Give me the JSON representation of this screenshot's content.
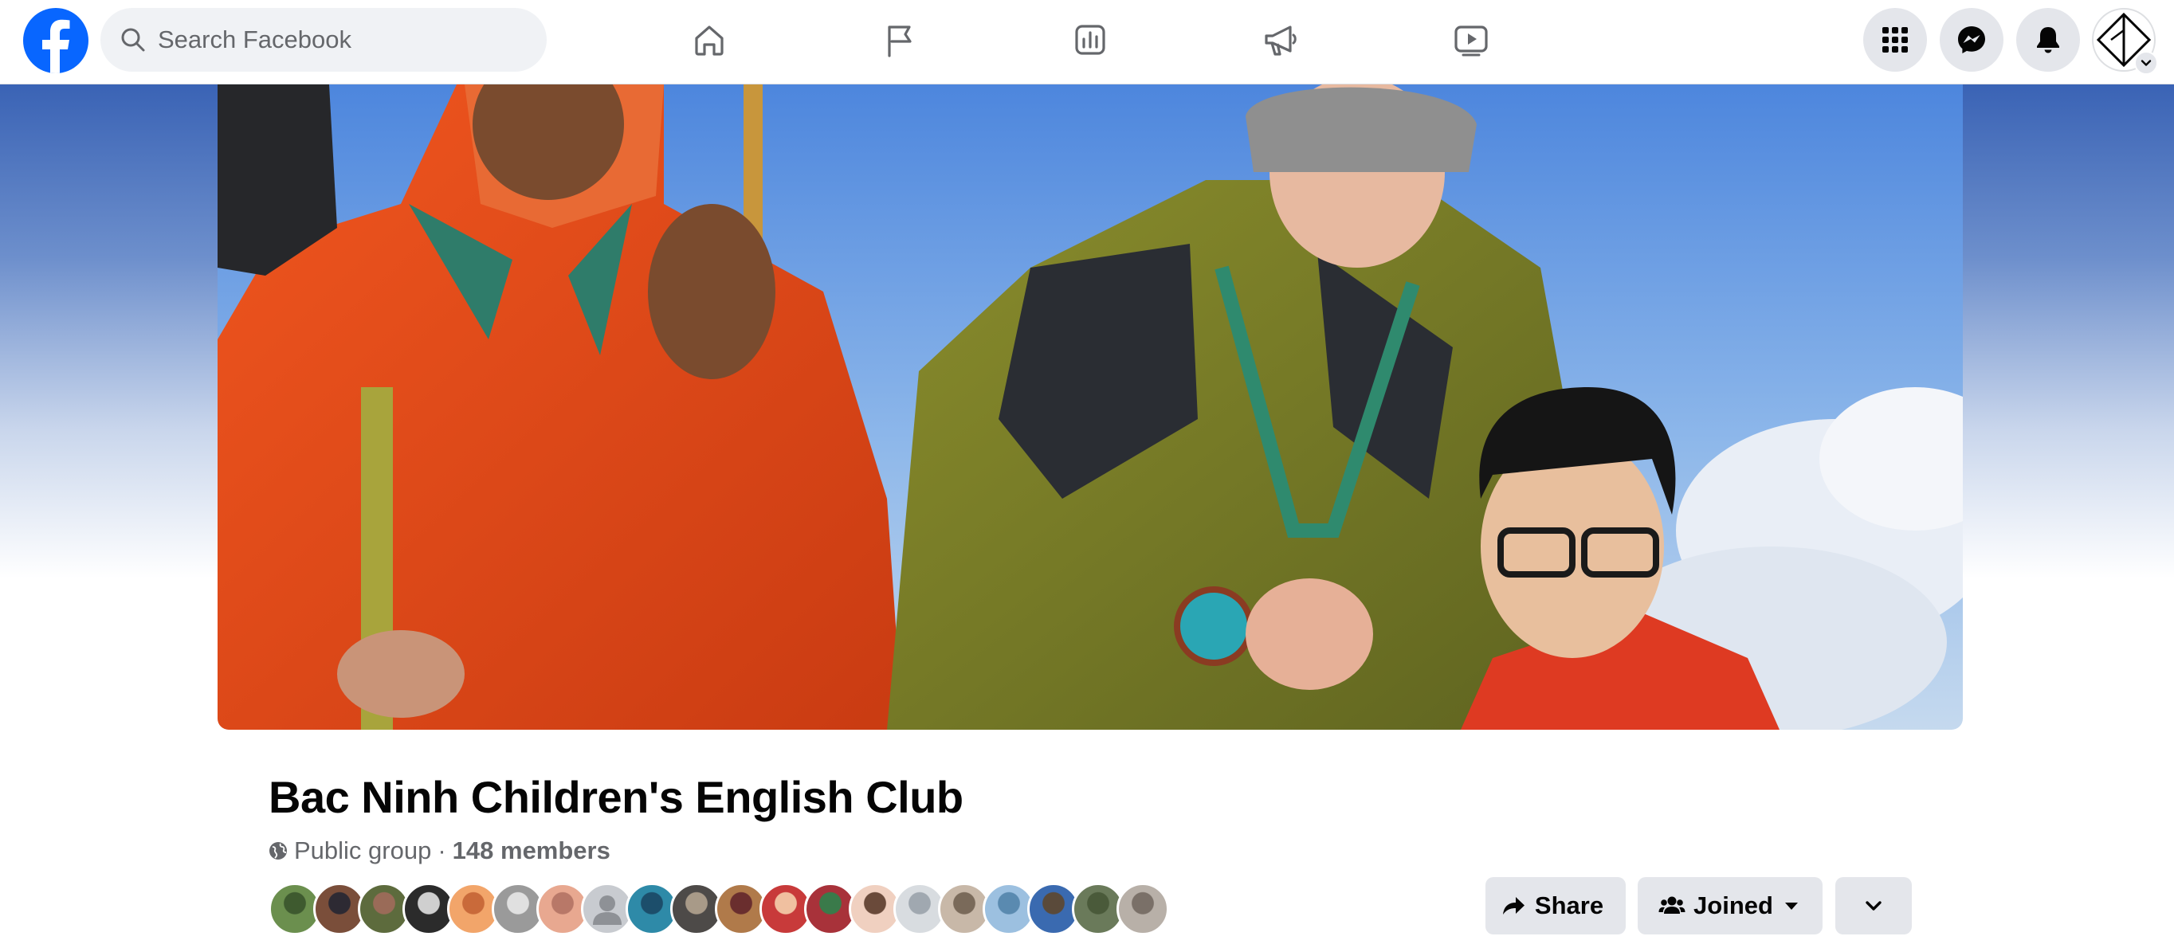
{
  "topbar": {
    "logo_icon": "facebook-logo-icon",
    "search": {
      "placeholder": "Search Facebook",
      "value": ""
    },
    "nav": [
      {
        "icon": "home-icon"
      },
      {
        "icon": "flag-icon"
      },
      {
        "icon": "insights-chart-icon"
      },
      {
        "icon": "megaphone-icon"
      },
      {
        "icon": "video-play-icon"
      }
    ],
    "right_buttons": [
      {
        "icon": "menu-grid-icon"
      },
      {
        "icon": "messenger-icon"
      },
      {
        "icon": "bell-icon"
      }
    ],
    "account_icon": "account-avatar-icon"
  },
  "colors": {
    "brand": "#0866ff",
    "text_primary": "#050505",
    "text_secondary": "#65676b",
    "button_bg": "#e4e6eb",
    "search_bg": "#f0f2f5"
  },
  "group": {
    "name": "Bac Ninh Children's English Club",
    "privacy": "Public group",
    "separator": "·",
    "members": "148 members",
    "member_avatar_count": 20
  },
  "actions": {
    "share_label": "Share",
    "joined_label": "Joined"
  }
}
